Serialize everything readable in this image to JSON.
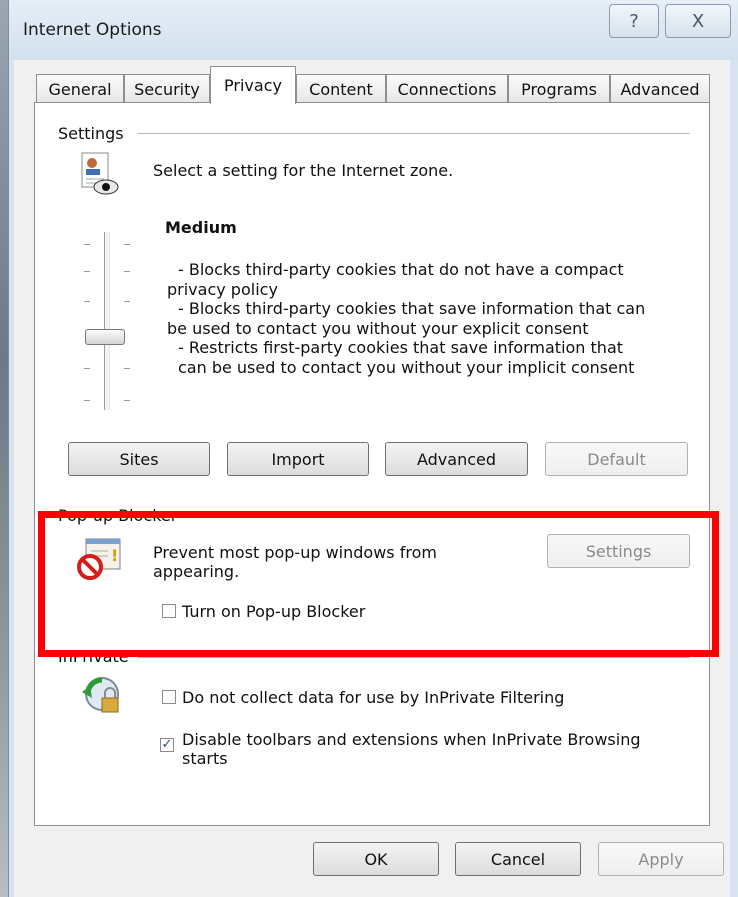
{
  "window": {
    "title": "Internet Options",
    "help_glyph": "?",
    "close_glyph": "X"
  },
  "tabs": [
    "General",
    "Security",
    "Privacy",
    "Content",
    "Connections",
    "Programs",
    "Advanced"
  ],
  "settings": {
    "group_label": "Settings",
    "zone_text": "Select a setting for the Internet zone.",
    "level": "Medium",
    "description_lines": [
      "- Blocks third-party cookies that do not have a compact",
      "privacy policy",
      "- Blocks third-party cookies that save information that can",
      "be used to contact you without your explicit consent",
      "- Restricts first-party cookies that save information that",
      "can be used to contact you without your implicit consent"
    ],
    "buttons": {
      "sites": "Sites",
      "import": "Import",
      "advanced": "Advanced",
      "default": "Default"
    }
  },
  "popup": {
    "group_label": "Pop-up Blocker",
    "description_lines": [
      "Prevent most pop-up windows from",
      "appearing."
    ],
    "settings_button": "Settings",
    "checkbox_label": "Turn on Pop-up Blocker"
  },
  "inprivate": {
    "group_label": "InPrivate",
    "cb1_label": "Do not collect data for use by InPrivate Filtering",
    "cb2_lines": [
      "Disable toolbars and extensions when InPrivate Browsing",
      "starts"
    ]
  },
  "footer": {
    "ok": "OK",
    "cancel": "Cancel",
    "apply": "Apply"
  },
  "states": {
    "active_tab": "Privacy",
    "default_disabled": true,
    "popup_settings_disabled": true,
    "apply_disabled": true,
    "popup_checkbox_checked": false,
    "cb1_checked": false,
    "cb2_checked": true,
    "privacy_slider_level": "Medium"
  }
}
